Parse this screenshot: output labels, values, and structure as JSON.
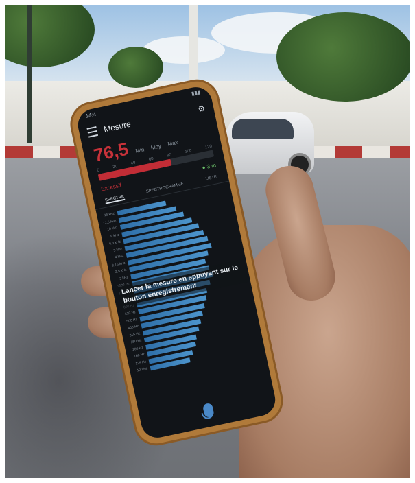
{
  "status_bar": {
    "time": "14:4"
  },
  "app_bar": {
    "title": "Mesure"
  },
  "reading": {
    "value": "76,5",
    "labels": [
      "Min",
      "Moy",
      "Max"
    ]
  },
  "meter": {
    "scale": [
      "0",
      "20",
      "40",
      "60",
      "80",
      "100",
      "120"
    ],
    "fill_fraction": 0.63
  },
  "info": {
    "alert": "Excessif",
    "distance": "3 m"
  },
  "tabs": [
    "SPECTRE",
    "SPECTROGRAMME",
    "LISTE"
  ],
  "spectrum": {
    "bands": [
      {
        "label": "16 kHz",
        "level": 0.55
      },
      {
        "label": "12,5 kHz",
        "level": 0.65
      },
      {
        "label": "10 kHz",
        "level": 0.72
      },
      {
        "label": "8 kHz",
        "level": 0.8
      },
      {
        "label": "6,3 kHz",
        "level": 0.86
      },
      {
        "label": "5 kHz",
        "level": 0.9
      },
      {
        "label": "4 kHz",
        "level": 0.93
      },
      {
        "label": "3,15 kHz",
        "level": 0.95
      },
      {
        "label": "2,5 kHz",
        "level": 0.9
      },
      {
        "label": "2 kHz",
        "level": 0.85
      },
      {
        "label": "1600 Hz",
        "level": 0.88
      },
      {
        "label": "1250 Hz",
        "level": 0.9
      },
      {
        "label": "1 kHz",
        "level": 0.85
      },
      {
        "label": "800 Hz",
        "level": 0.8
      },
      {
        "label": "630 Hz",
        "level": 0.78
      },
      {
        "label": "500 Hz",
        "level": 0.74
      },
      {
        "label": "400 Hz",
        "level": 0.7
      },
      {
        "label": "315 Hz",
        "level": 0.66
      },
      {
        "label": "250 Hz",
        "level": 0.62
      },
      {
        "label": "200 Hz",
        "level": 0.58
      },
      {
        "label": "160 Hz",
        "level": 0.55
      },
      {
        "label": "125 Hz",
        "level": 0.5
      },
      {
        "label": "100 Hz",
        "level": 0.45
      }
    ]
  },
  "overlay_message": "Lancer la mesure en appuyant sur le bouton enregistrement",
  "colors": {
    "accent_red": "#c22d36",
    "bar_blue": "#4c94cc",
    "positive_green": "#6dc26b"
  }
}
